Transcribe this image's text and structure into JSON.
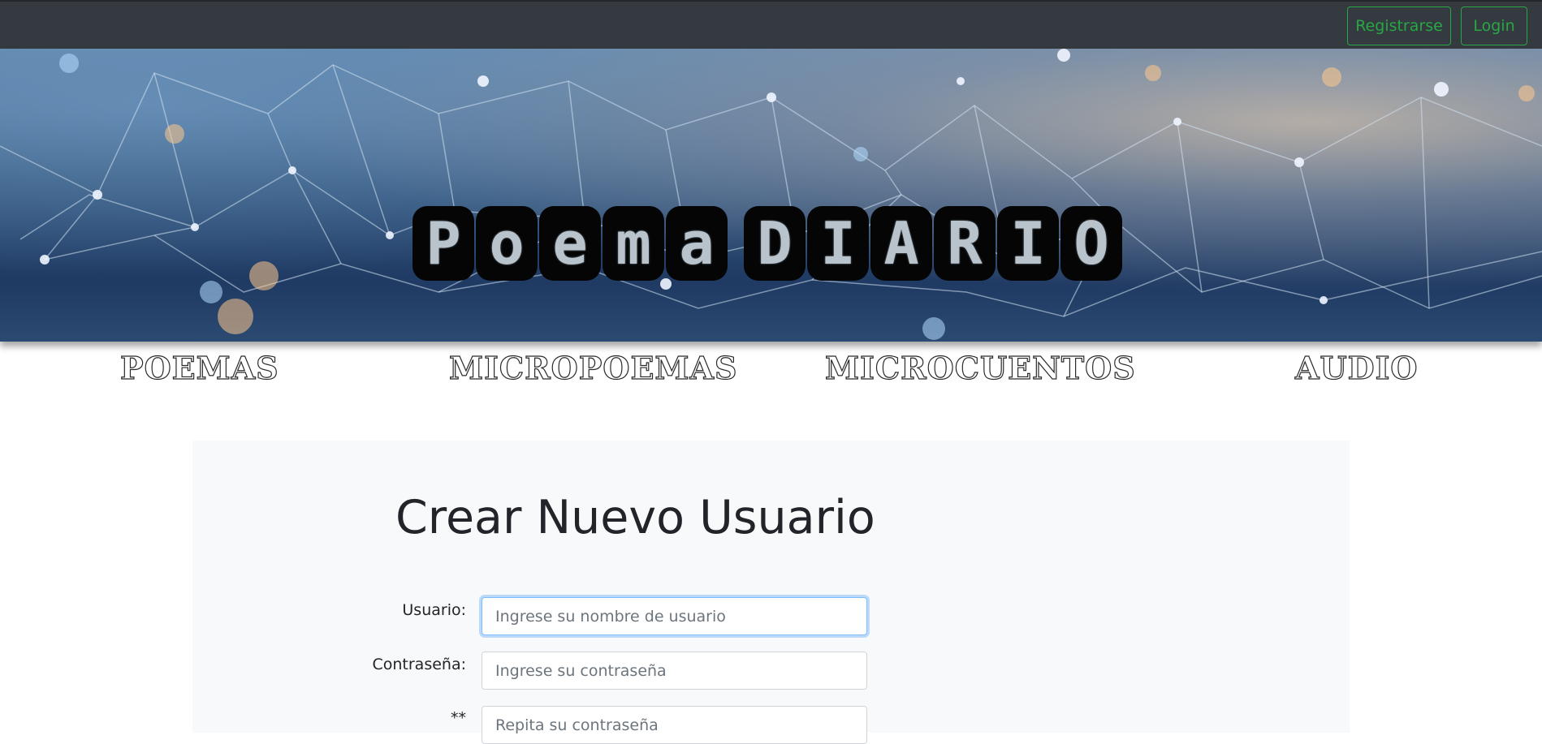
{
  "navbar": {
    "register_label": "Registrarse",
    "login_label": "Login",
    "accent": "#28a745"
  },
  "hero": {
    "logo_word1": [
      "P",
      "o",
      "e",
      "m",
      "a"
    ],
    "logo_word2": [
      "D",
      "I",
      "A",
      "R",
      "I",
      "O"
    ]
  },
  "categories": [
    {
      "label": "POEMAS"
    },
    {
      "label": "MICROPOEMAS"
    },
    {
      "label": "MICROCUENTOS"
    },
    {
      "label": "AUDIO"
    }
  ],
  "form": {
    "title": "Crear Nuevo Usuario",
    "username": {
      "label": "Usuario:",
      "placeholder": "Ingrese su nombre de usuario",
      "value": ""
    },
    "password": {
      "label": "Contraseña:",
      "placeholder": "Ingrese su contraseña",
      "value": ""
    },
    "repeat": {
      "label": "**",
      "placeholder": "Repita su contraseña",
      "value": ""
    }
  }
}
